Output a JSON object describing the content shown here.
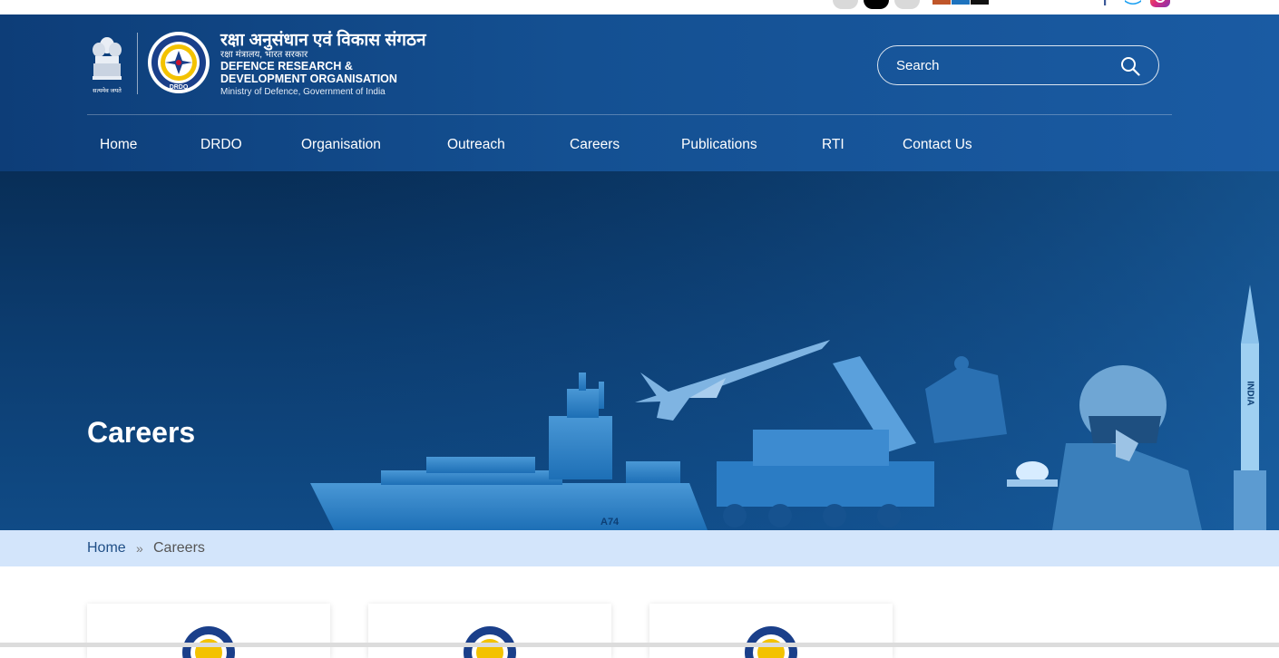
{
  "header": {
    "emblem_caption": "सत्यमेव जयते",
    "org_name_hindi": "रक्षा अनुसंधान एवं विकास संगठन",
    "ministry_hindi": "रक्षा मंत्रालय, भारत सरकार",
    "org_name_en_line1": "DEFENCE RESEARCH &",
    "org_name_en_line2": "DEVELOPMENT ORGANISATION",
    "ministry_en": "Ministry of Defence, Government of India",
    "logo_text": "DRDO"
  },
  "search": {
    "placeholder": "Search",
    "icon": "search-icon"
  },
  "nav": {
    "items": [
      {
        "label": "Home"
      },
      {
        "label": "DRDO"
      },
      {
        "label": "Organisation"
      },
      {
        "label": "Outreach"
      },
      {
        "label": "Careers"
      },
      {
        "label": "Publications"
      },
      {
        "label": "RTI"
      },
      {
        "label": "Contact Us"
      }
    ]
  },
  "hero": {
    "title": "Careers",
    "ship_number": "A74",
    "missile_text": "INDIA"
  },
  "breadcrumb": {
    "home": "Home",
    "separator": "»",
    "current": "Careers"
  },
  "colors": {
    "header_blue": "#145092",
    "hero_blue": "#0c3c6f",
    "breadcrumb_bg": "#d3e5fb",
    "breadcrumb_link": "#1f4e86",
    "breadcrumb_current": "#555555",
    "facebook": "#3b5998",
    "twitter": "#1da1f2",
    "instagram": "#e1306c"
  },
  "social": [
    "facebook-icon",
    "twitter-icon",
    "instagram-icon"
  ]
}
